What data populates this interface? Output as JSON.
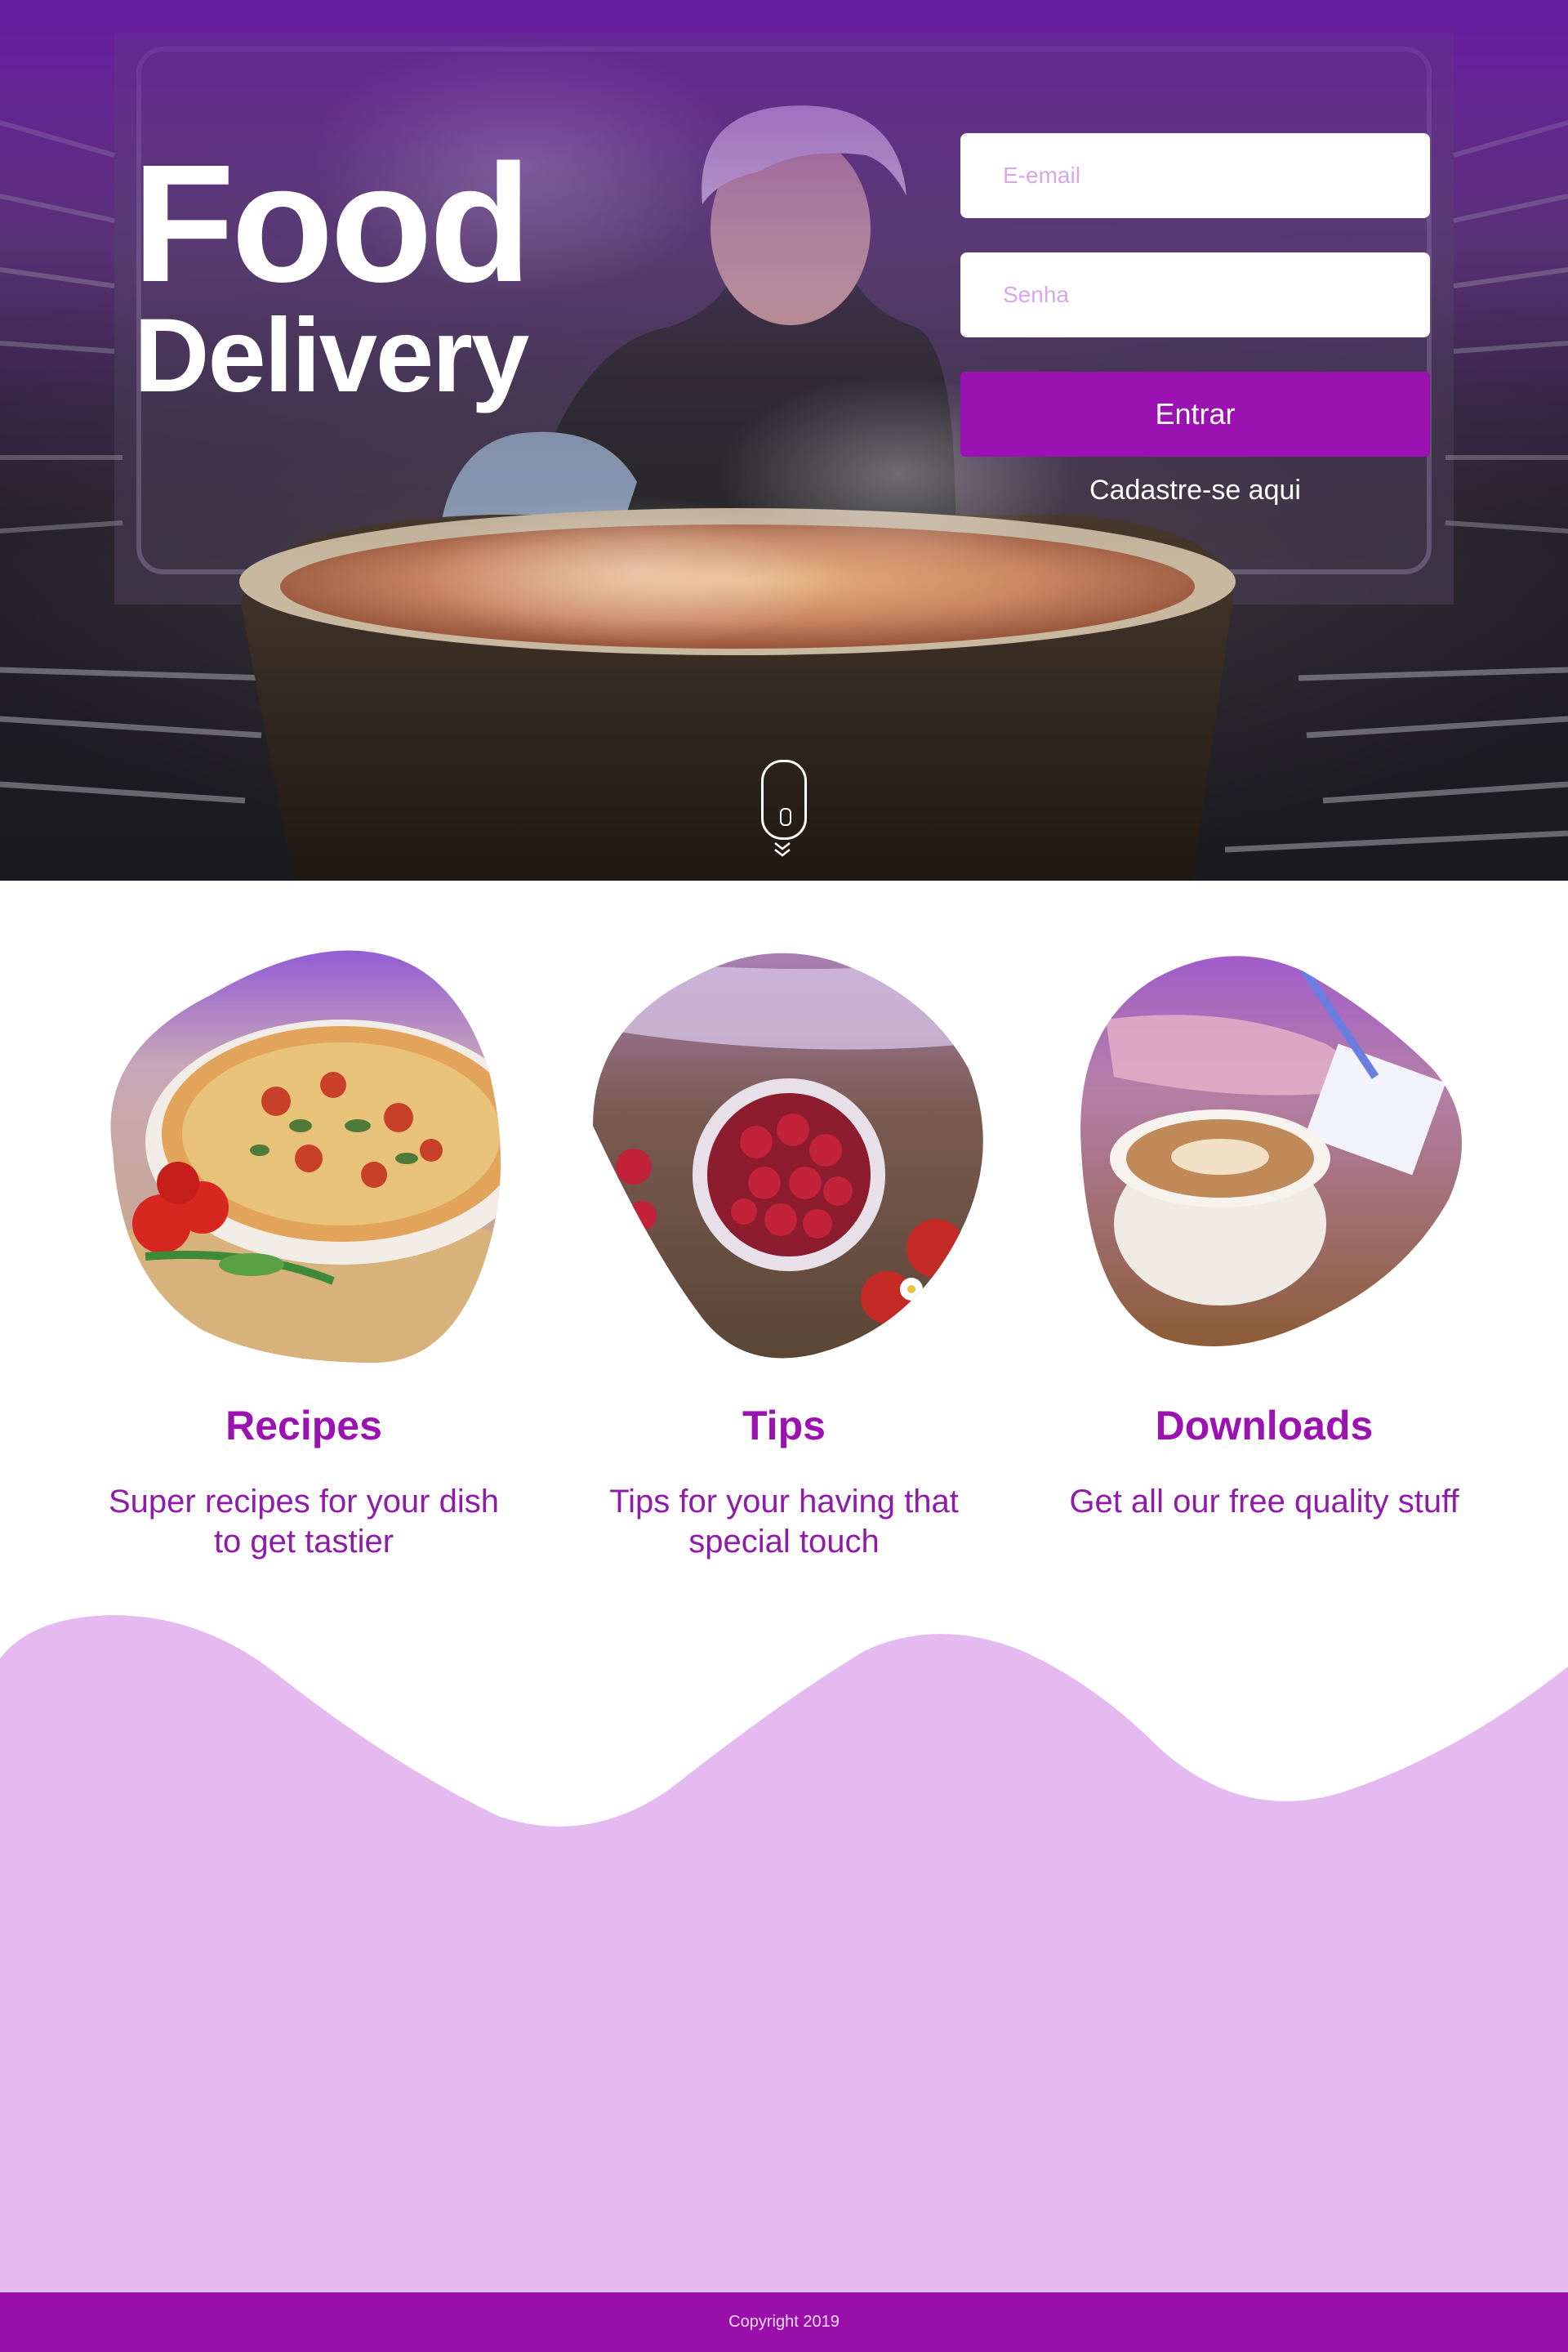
{
  "hero": {
    "title_line1": "Food",
    "title_line2": "Delivery",
    "scroll_indicator_icon": "mouse-scroll-icon"
  },
  "login": {
    "email_placeholder": "E-email",
    "email_value": "",
    "password_placeholder": "Senha",
    "password_value": "",
    "submit_label": "Entrar",
    "signup_link": "Cadastre-se aqui"
  },
  "features": [
    {
      "title": "Recipes",
      "description": "Super recipes for your dish to get tastier",
      "image": "pizza-photo"
    },
    {
      "title": "Tips",
      "description": "Tips for your having that special touch",
      "image": "raspberries-photo"
    },
    {
      "title": "Downloads",
      "description": "Get all our free quality stuff",
      "image": "coffee-photo"
    }
  ],
  "footer": {
    "copyright": "Copyright 2019"
  },
  "colors": {
    "brand_purple": "#9b11b1",
    "wave_lilac": "#e4baf0",
    "feature_text": "#8f1ca8",
    "footer_bg": "#9a0ea9"
  }
}
